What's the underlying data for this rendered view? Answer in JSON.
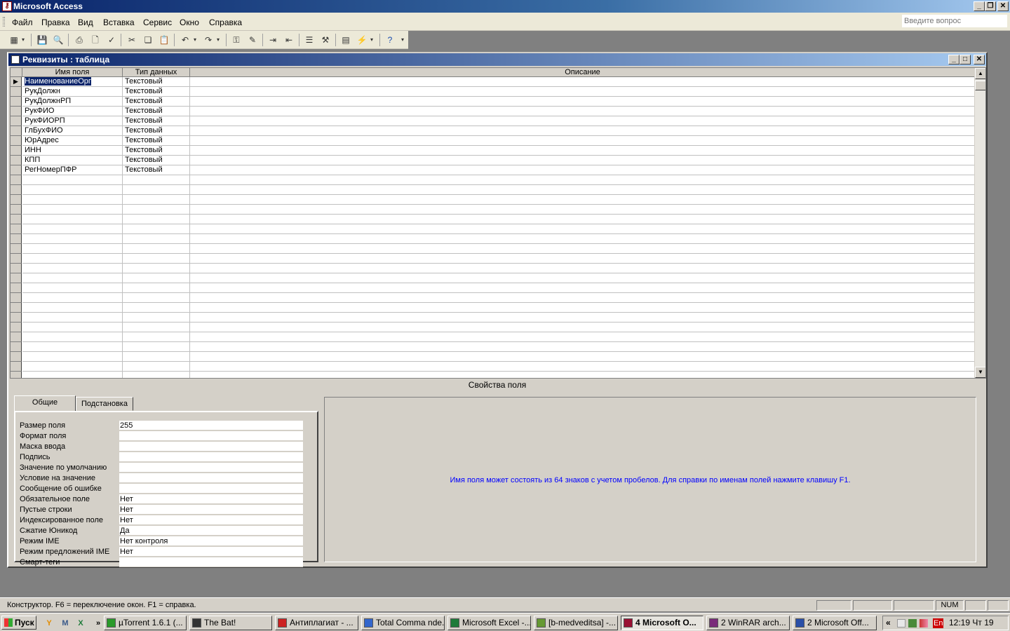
{
  "app": {
    "title": "Microsoft Access"
  },
  "menu": {
    "items": [
      "Файл",
      "Правка",
      "Вид",
      "Вставка",
      "Сервис",
      "Окно",
      "Справка"
    ],
    "ask_placeholder": "Введите вопрос"
  },
  "window": {
    "title": "Реквизиты : таблица"
  },
  "grid": {
    "headers": [
      "Имя поля",
      "Тип данных",
      "Описание"
    ],
    "rows": [
      {
        "name": "НаименованиеОрг",
        "type": "Текстовый"
      },
      {
        "name": "РукДолжн",
        "type": "Текстовый"
      },
      {
        "name": "РукДолжнРП",
        "type": "Текстовый"
      },
      {
        "name": "РукФИО",
        "type": "Текстовый"
      },
      {
        "name": "РукФИОРП",
        "type": "Текстовый"
      },
      {
        "name": "ГлБухФИО",
        "type": "Текстовый"
      },
      {
        "name": "ЮрАдрес",
        "type": "Текстовый"
      },
      {
        "name": "ИНН",
        "type": "Текстовый"
      },
      {
        "name": "КПП",
        "type": "Текстовый"
      },
      {
        "name": "РегНомерПФР",
        "type": "Текстовый"
      }
    ]
  },
  "props": {
    "heading": "Свойства поля",
    "tabs": [
      "Общие",
      "Подстановка"
    ],
    "fields": [
      {
        "label": "Размер поля",
        "value": "255"
      },
      {
        "label": "Формат поля",
        "value": ""
      },
      {
        "label": "Маска ввода",
        "value": ""
      },
      {
        "label": "Подпись",
        "value": ""
      },
      {
        "label": "Значение по умолчанию",
        "value": ""
      },
      {
        "label": "Условие на значение",
        "value": ""
      },
      {
        "label": "Сообщение об ошибке",
        "value": ""
      },
      {
        "label": "Обязательное поле",
        "value": "Нет"
      },
      {
        "label": "Пустые строки",
        "value": "Нет"
      },
      {
        "label": "Индексированное поле",
        "value": "Нет"
      },
      {
        "label": "Сжатие Юникод",
        "value": "Да"
      },
      {
        "label": "Режим IME",
        "value": "Нет контроля"
      },
      {
        "label": "Режим предложений IME",
        "value": "Нет"
      },
      {
        "label": "Смарт-теги",
        "value": ""
      }
    ],
    "hint": "Имя поля может состоять из 64 знаков с учетом пробелов.  Для справки по именам полей нажмите клавишу F1."
  },
  "status": {
    "text": "Конструктор.  F6 = переключение окон.  F1 = справка.",
    "num": "NUM"
  },
  "taskbar": {
    "start": "Пуск",
    "tasks": [
      {
        "label": "µTorrent 1.6.1 (...",
        "icon": "utorrent-icon",
        "color": "#2a9a2a"
      },
      {
        "label": "The Bat!",
        "icon": "the-bat-icon",
        "color": "#333333"
      },
      {
        "label": "Антиплагиат - ...",
        "icon": "opera-icon",
        "color": "#cc2222"
      },
      {
        "label": "Total Comma nde...",
        "icon": "total-commander-icon",
        "color": "#3366cc"
      },
      {
        "label": "Microsoft Excel -...",
        "icon": "excel-icon",
        "color": "#1e7b3a"
      },
      {
        "label": "[b-medveditsa] -...",
        "icon": "notepad-icon",
        "color": "#669933"
      },
      {
        "label": "4 Microsoft O...",
        "icon": "access-icon",
        "color": "#991133",
        "active": true
      },
      {
        "label": "2 WinRAR arch...",
        "icon": "winrar-icon",
        "color": "#7a2a7a"
      },
      {
        "label": "2 Microsoft Off...",
        "icon": "word-icon",
        "color": "#2a4fa8"
      }
    ],
    "lang": "En",
    "clock": "12:19 Чт 19"
  }
}
